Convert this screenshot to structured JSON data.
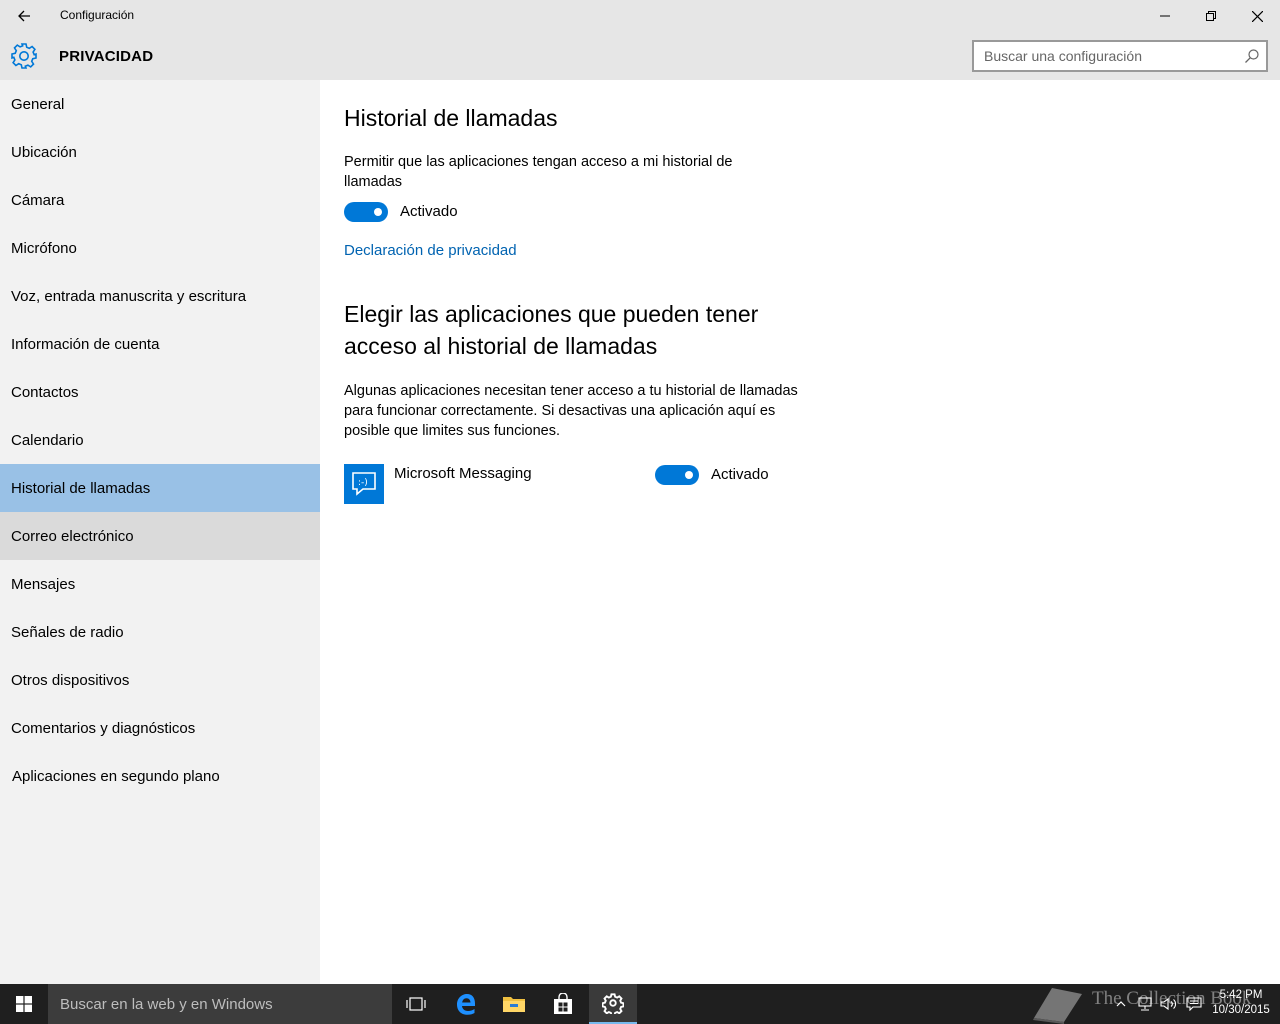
{
  "window": {
    "title": "Configuración"
  },
  "header": {
    "section_title": "PRIVACIDAD",
    "search_placeholder": "Buscar una configuración"
  },
  "sidebar": {
    "items": [
      {
        "label": "General"
      },
      {
        "label": "Ubicación"
      },
      {
        "label": "Cámara"
      },
      {
        "label": "Micrófono"
      },
      {
        "label": "Voz, entrada manuscrita y escritura"
      },
      {
        "label": "Información de cuenta"
      },
      {
        "label": "Contactos"
      },
      {
        "label": "Calendario"
      },
      {
        "label": "Historial de llamadas",
        "selected": true
      },
      {
        "label": "Correo electrónico",
        "hover": true
      },
      {
        "label": "Mensajes"
      },
      {
        "label": "Señales de radio"
      },
      {
        "label": "Otros dispositivos"
      },
      {
        "label": "Comentarios y diagnósticos"
      },
      {
        "label": "Aplicaciones en segundo plano"
      }
    ]
  },
  "main": {
    "heading": "Historial de llamadas",
    "allow_text": "Permitir que las aplicaciones tengan acceso a mi historial de llamadas",
    "master_toggle": {
      "state": "on",
      "label": "Activado"
    },
    "privacy_link": "Declaración de privacidad",
    "choose_heading": "Elegir las aplicaciones que pueden tener acceso al historial de llamadas",
    "choose_text": "Algunas aplicaciones necesitan tener acceso a tu historial de llamadas para funcionar correctamente. Si desactivas una aplicación aquí es posible que limites sus funciones.",
    "apps": [
      {
        "name": "Microsoft Messaging",
        "icon": "messaging-icon",
        "toggle_state": "on",
        "toggle_label": "Activado"
      }
    ]
  },
  "taskbar": {
    "search_text": "Buscar en la web y en Windows",
    "time": "5:42 PM",
    "date": "10/30/2015",
    "watermark": "The Collection Book"
  },
  "colors": {
    "accent": "#0078d7",
    "selected_nav": "#99c1e6",
    "link": "#0063b1"
  }
}
